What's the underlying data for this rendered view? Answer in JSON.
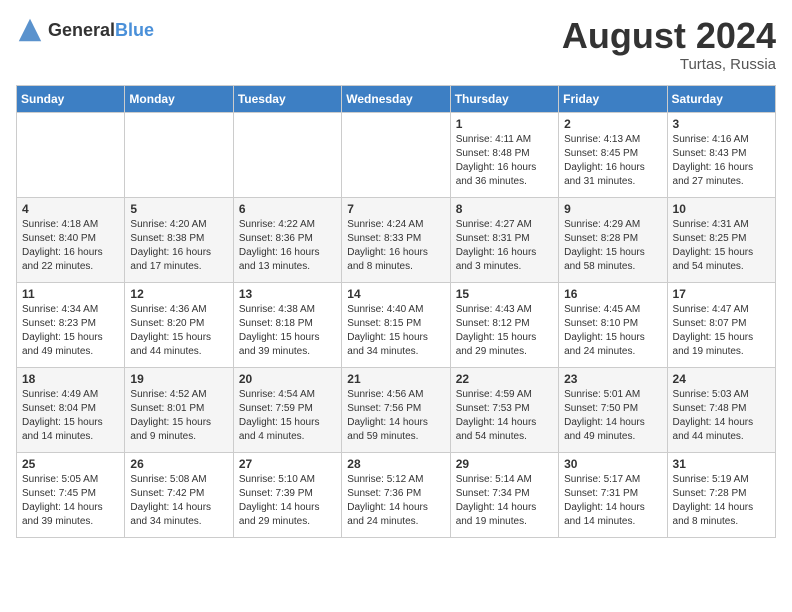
{
  "header": {
    "logo_general": "General",
    "logo_blue": "Blue",
    "month_year": "August 2024",
    "location": "Turtas, Russia"
  },
  "days_of_week": [
    "Sunday",
    "Monday",
    "Tuesday",
    "Wednesday",
    "Thursday",
    "Friday",
    "Saturday"
  ],
  "weeks": [
    [
      {
        "day": "",
        "info": ""
      },
      {
        "day": "",
        "info": ""
      },
      {
        "day": "",
        "info": ""
      },
      {
        "day": "",
        "info": ""
      },
      {
        "day": "1",
        "info": "Sunrise: 4:11 AM\nSunset: 8:48 PM\nDaylight: 16 hours\nand 36 minutes."
      },
      {
        "day": "2",
        "info": "Sunrise: 4:13 AM\nSunset: 8:45 PM\nDaylight: 16 hours\nand 31 minutes."
      },
      {
        "day": "3",
        "info": "Sunrise: 4:16 AM\nSunset: 8:43 PM\nDaylight: 16 hours\nand 27 minutes."
      }
    ],
    [
      {
        "day": "4",
        "info": "Sunrise: 4:18 AM\nSunset: 8:40 PM\nDaylight: 16 hours\nand 22 minutes."
      },
      {
        "day": "5",
        "info": "Sunrise: 4:20 AM\nSunset: 8:38 PM\nDaylight: 16 hours\nand 17 minutes."
      },
      {
        "day": "6",
        "info": "Sunrise: 4:22 AM\nSunset: 8:36 PM\nDaylight: 16 hours\nand 13 minutes."
      },
      {
        "day": "7",
        "info": "Sunrise: 4:24 AM\nSunset: 8:33 PM\nDaylight: 16 hours\nand 8 minutes."
      },
      {
        "day": "8",
        "info": "Sunrise: 4:27 AM\nSunset: 8:31 PM\nDaylight: 16 hours\nand 3 minutes."
      },
      {
        "day": "9",
        "info": "Sunrise: 4:29 AM\nSunset: 8:28 PM\nDaylight: 15 hours\nand 58 minutes."
      },
      {
        "day": "10",
        "info": "Sunrise: 4:31 AM\nSunset: 8:25 PM\nDaylight: 15 hours\nand 54 minutes."
      }
    ],
    [
      {
        "day": "11",
        "info": "Sunrise: 4:34 AM\nSunset: 8:23 PM\nDaylight: 15 hours\nand 49 minutes."
      },
      {
        "day": "12",
        "info": "Sunrise: 4:36 AM\nSunset: 8:20 PM\nDaylight: 15 hours\nand 44 minutes."
      },
      {
        "day": "13",
        "info": "Sunrise: 4:38 AM\nSunset: 8:18 PM\nDaylight: 15 hours\nand 39 minutes."
      },
      {
        "day": "14",
        "info": "Sunrise: 4:40 AM\nSunset: 8:15 PM\nDaylight: 15 hours\nand 34 minutes."
      },
      {
        "day": "15",
        "info": "Sunrise: 4:43 AM\nSunset: 8:12 PM\nDaylight: 15 hours\nand 29 minutes."
      },
      {
        "day": "16",
        "info": "Sunrise: 4:45 AM\nSunset: 8:10 PM\nDaylight: 15 hours\nand 24 minutes."
      },
      {
        "day": "17",
        "info": "Sunrise: 4:47 AM\nSunset: 8:07 PM\nDaylight: 15 hours\nand 19 minutes."
      }
    ],
    [
      {
        "day": "18",
        "info": "Sunrise: 4:49 AM\nSunset: 8:04 PM\nDaylight: 15 hours\nand 14 minutes."
      },
      {
        "day": "19",
        "info": "Sunrise: 4:52 AM\nSunset: 8:01 PM\nDaylight: 15 hours\nand 9 minutes."
      },
      {
        "day": "20",
        "info": "Sunrise: 4:54 AM\nSunset: 7:59 PM\nDaylight: 15 hours\nand 4 minutes."
      },
      {
        "day": "21",
        "info": "Sunrise: 4:56 AM\nSunset: 7:56 PM\nDaylight: 14 hours\nand 59 minutes."
      },
      {
        "day": "22",
        "info": "Sunrise: 4:59 AM\nSunset: 7:53 PM\nDaylight: 14 hours\nand 54 minutes."
      },
      {
        "day": "23",
        "info": "Sunrise: 5:01 AM\nSunset: 7:50 PM\nDaylight: 14 hours\nand 49 minutes."
      },
      {
        "day": "24",
        "info": "Sunrise: 5:03 AM\nSunset: 7:48 PM\nDaylight: 14 hours\nand 44 minutes."
      }
    ],
    [
      {
        "day": "25",
        "info": "Sunrise: 5:05 AM\nSunset: 7:45 PM\nDaylight: 14 hours\nand 39 minutes."
      },
      {
        "day": "26",
        "info": "Sunrise: 5:08 AM\nSunset: 7:42 PM\nDaylight: 14 hours\nand 34 minutes."
      },
      {
        "day": "27",
        "info": "Sunrise: 5:10 AM\nSunset: 7:39 PM\nDaylight: 14 hours\nand 29 minutes."
      },
      {
        "day": "28",
        "info": "Sunrise: 5:12 AM\nSunset: 7:36 PM\nDaylight: 14 hours\nand 24 minutes."
      },
      {
        "day": "29",
        "info": "Sunrise: 5:14 AM\nSunset: 7:34 PM\nDaylight: 14 hours\nand 19 minutes."
      },
      {
        "day": "30",
        "info": "Sunrise: 5:17 AM\nSunset: 7:31 PM\nDaylight: 14 hours\nand 14 minutes."
      },
      {
        "day": "31",
        "info": "Sunrise: 5:19 AM\nSunset: 7:28 PM\nDaylight: 14 hours\nand 8 minutes."
      }
    ]
  ]
}
